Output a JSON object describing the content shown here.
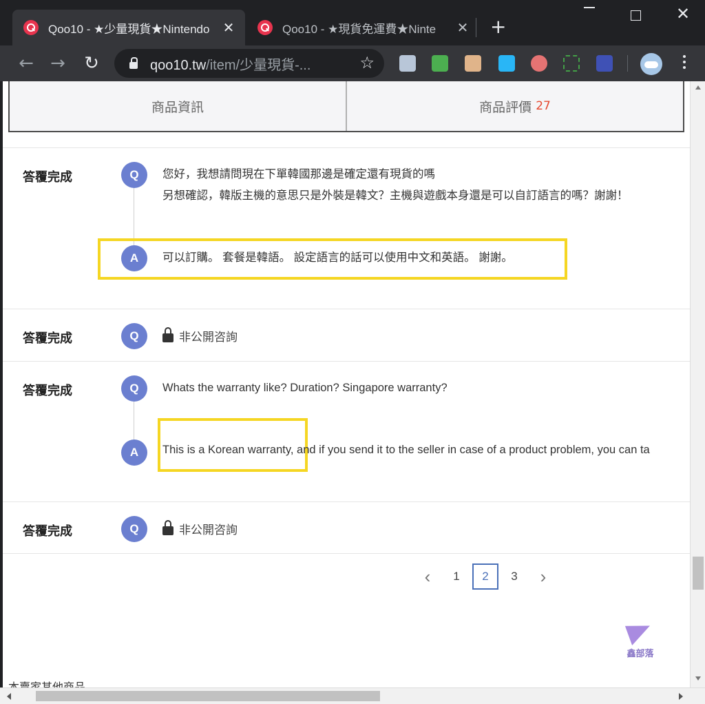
{
  "browser": {
    "tabs": [
      {
        "title": "Qoo10 - ★少量現貨★Nintendo",
        "close": "✕"
      },
      {
        "title": "Qoo10 - ★現貨免運費★Ninte",
        "close": "✕"
      }
    ],
    "new_tab": "+",
    "url_host": "qoo10.tw",
    "url_path": "/item/少量現貨-...",
    "nav": {
      "back": "←",
      "forward": "→",
      "reload": "↻"
    },
    "star": "☆",
    "extensions": [
      "ext-1",
      "ext-2",
      "ext-3",
      "ext-4",
      "ext-5",
      "ext-6",
      "ext-7"
    ]
  },
  "product_tabs": {
    "info_label": "商品資訊",
    "reviews_label": "商品評價",
    "reviews_count": "27"
  },
  "qa": [
    {
      "status": "答覆完成",
      "q_mark": "Q",
      "question_lines": [
        "您好，我想請問現在下單韓國那邊是確定還有現貨的嗎",
        "另想確認，韓版主機的意思只是外裝是韓文？主機與遊戲本身還是可以自訂語言的嗎？謝謝！"
      ],
      "a_mark": "A",
      "answer": "可以訂購。 套餐是韓語。 設定語言的話可以使用中文和英語。 謝謝。"
    },
    {
      "status": "答覆完成",
      "q_mark": "Q",
      "private_label": "非公開咨詢"
    },
    {
      "status": "答覆完成",
      "q_mark": "Q",
      "question_lines": [
        "Whats the warranty like? Duration? Singapore warranty?"
      ],
      "a_mark": "A",
      "answer": "This is a Korean warranty, and if you send it to the seller in case of a product problem, you can ta"
    },
    {
      "status": "答覆完成",
      "q_mark": "Q",
      "private_label": "非公開咨詢"
    }
  ],
  "pagination": {
    "prev": "‹",
    "pages": [
      "1",
      "2",
      "3"
    ],
    "current": "2",
    "next": "›"
  },
  "watermark": {
    "text": "鑫部落"
  },
  "bottom_peek": "本賣家其他商品"
}
